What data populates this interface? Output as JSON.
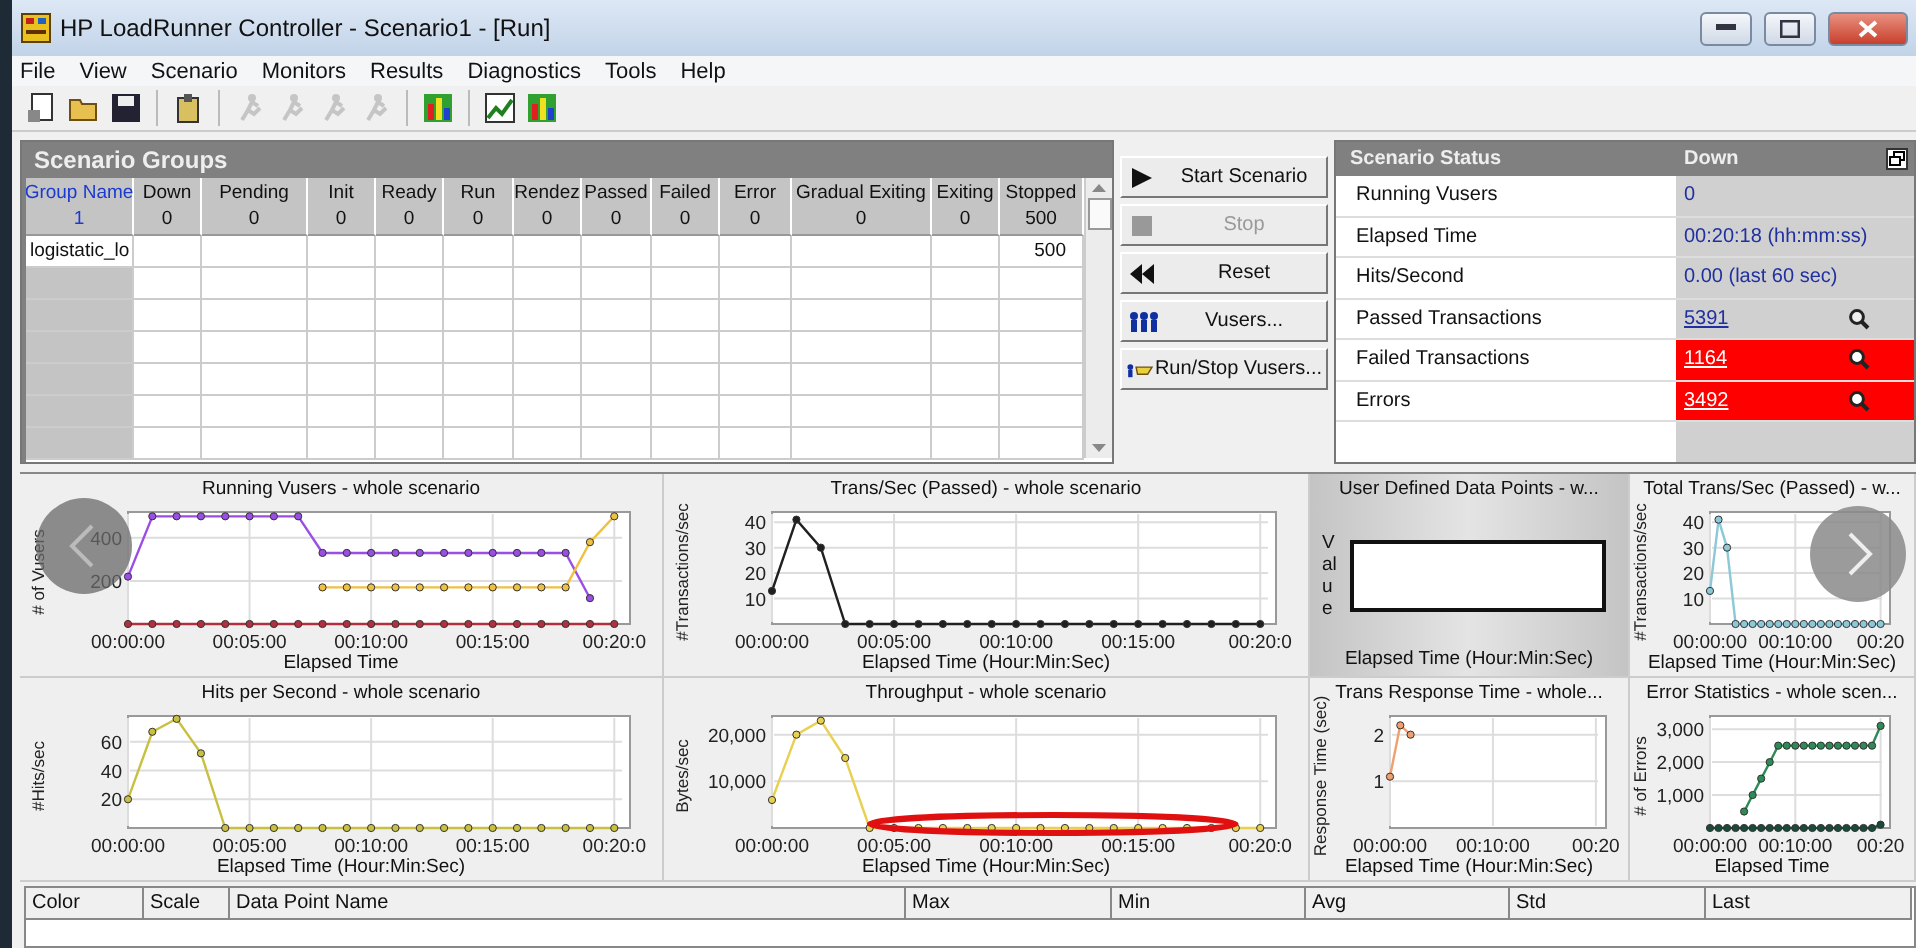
{
  "window": {
    "title": "HP LoadRunner Controller - Scenario1 - [Run]"
  },
  "menu": [
    "File",
    "View",
    "Scenario",
    "Monitors",
    "Results",
    "Diagnostics",
    "Tools",
    "Help"
  ],
  "toolbar": [
    {
      "kind": "new",
      "disabled": false
    },
    {
      "kind": "open",
      "disabled": false
    },
    {
      "kind": "save",
      "disabled": false
    },
    {
      "kind": "host",
      "disabled": false
    },
    {
      "kind": "run",
      "disabled": true
    },
    {
      "kind": "run",
      "disabled": true
    },
    {
      "kind": "run",
      "disabled": true
    },
    {
      "kind": "run",
      "disabled": true
    },
    {
      "kind": "monitor",
      "disabled": false
    },
    {
      "kind": "analysis",
      "disabled": false
    },
    {
      "kind": "monitor",
      "disabled": false
    }
  ],
  "scenario_groups": {
    "title": "Scenario Groups",
    "columns": [
      {
        "name": "Group Name",
        "total": "1"
      },
      {
        "name": "Down",
        "total": "0"
      },
      {
        "name": "Pending",
        "total": "0"
      },
      {
        "name": "Init",
        "total": "0"
      },
      {
        "name": "Ready",
        "total": "0"
      },
      {
        "name": "Run",
        "total": "0"
      },
      {
        "name": "Rendez",
        "total": "0"
      },
      {
        "name": "Passed",
        "total": "0"
      },
      {
        "name": "Failed",
        "total": "0"
      },
      {
        "name": "Error",
        "total": "0"
      },
      {
        "name": "Gradual Exiting",
        "total": "0"
      },
      {
        "name": "Exiting",
        "total": "0"
      },
      {
        "name": "Stopped",
        "total": "500"
      }
    ],
    "rows": [
      {
        "group_name": "logistatic_lo",
        "stopped": "500"
      }
    ]
  },
  "buttons": [
    {
      "label": "Start Scenario",
      "kind": "start",
      "disabled": false
    },
    {
      "label": "Stop",
      "kind": "stop",
      "disabled": true
    },
    {
      "label": "Reset",
      "kind": "reset",
      "disabled": false
    },
    {
      "label": "Vusers...",
      "kind": "vusers",
      "disabled": false
    },
    {
      "label": "Run/Stop Vusers...",
      "kind": "runstop",
      "disabled": false
    }
  ],
  "scenario_status": {
    "title": "Scenario Status",
    "state": "Down",
    "rows": [
      {
        "label": "Running Vusers",
        "value": "0",
        "kind": "text",
        "alert": false
      },
      {
        "label": "Elapsed Time",
        "value": "00:20:18 (hh:mm:ss)",
        "kind": "text",
        "alert": false
      },
      {
        "label": "Hits/Second",
        "value": "0.00 (last 60 sec)",
        "kind": "text",
        "alert": false
      },
      {
        "label": "Passed Transactions",
        "value": "5391",
        "kind": "link",
        "alert": false
      },
      {
        "label": "Failed Transactions",
        "value": "1164",
        "kind": "link",
        "alert": true
      },
      {
        "label": "Errors",
        "value": "3492",
        "kind": "link",
        "alert": true
      }
    ]
  },
  "graphs": [
    {
      "kind": "chart",
      "selected": false,
      "circled": false,
      "chart_data": {
        "type": "line",
        "title": "Running Vusers - whole scenario",
        "xlabel": "Elapsed Time",
        "ylabel": "# of Vusers",
        "grid": true,
        "x": [
          0,
          1,
          2,
          3,
          4,
          5,
          6,
          7,
          8,
          9,
          10,
          11,
          12,
          13,
          14,
          15,
          16,
          17,
          18,
          19,
          20
        ],
        "xlim": [
          0,
          20.4
        ],
        "ylim": [
          0,
          520
        ],
        "xticks": [
          {
            "value": 0,
            "label": "00:00:00"
          },
          {
            "value": 5,
            "label": "00:05:00"
          },
          {
            "value": 10,
            "label": "00:10:00"
          },
          {
            "value": 15,
            "label": "00:15:00"
          },
          {
            "value": 20,
            "label": "00:20:0"
          }
        ],
        "yticks": [
          200,
          400
        ],
        "series": [
          {
            "color": "#b03040",
            "marker": true,
            "values": [
              0,
              0,
              0,
              0,
              0,
              0,
              0,
              0,
              0,
              0,
              0,
              0,
              0,
              0,
              0,
              0,
              0,
              0,
              0,
              0,
              0
            ]
          },
          {
            "color": "#9a4ee6",
            "marker": true,
            "values": [
              220,
              500,
              500,
              500,
              500,
              500,
              500,
              500,
              330,
              330,
              330,
              330,
              330,
              330,
              330,
              330,
              330,
              330,
              330,
              120,
              null
            ]
          },
          {
            "color": "#f0c040",
            "marker": true,
            "values": [
              null,
              null,
              null,
              null,
              null,
              null,
              null,
              null,
              170,
              170,
              170,
              170,
              170,
              170,
              170,
              170,
              170,
              170,
              170,
              380,
              500
            ]
          }
        ]
      }
    },
    {
      "kind": "chart",
      "selected": false,
      "circled": false,
      "chart_data": {
        "type": "line",
        "title": "Trans/Sec (Passed) - whole scenario",
        "xlabel": "Elapsed Time (Hour:Min:Sec)",
        "ylabel": "#Transactions/sec",
        "grid": true,
        "x": [
          0,
          1,
          2,
          3,
          4,
          5,
          6,
          7,
          8,
          9,
          10,
          11,
          12,
          13,
          14,
          15,
          16,
          17,
          18,
          19,
          20
        ],
        "xlim": [
          0,
          20.4
        ],
        "ylim": [
          0,
          44
        ],
        "xticks": [
          {
            "value": 0,
            "label": "00:00:00"
          },
          {
            "value": 5,
            "label": "00:05:00"
          },
          {
            "value": 10,
            "label": "00:10:00"
          },
          {
            "value": 15,
            "label": "00:15:00"
          },
          {
            "value": 20,
            "label": "00:20:0"
          }
        ],
        "yticks": [
          10,
          20,
          30,
          40
        ],
        "series": [
          {
            "color": "#202020",
            "marker": true,
            "values": [
              13,
              41,
              30,
              0,
              0,
              0,
              0,
              0,
              0,
              0,
              0,
              0,
              0,
              0,
              0,
              0,
              0,
              0,
              0,
              0,
              0
            ]
          }
        ]
      }
    },
    {
      "kind": "empty",
      "selected": true,
      "title": "User Defined Data Points - w...",
      "ylabel": "Value",
      "xlabel": "Elapsed Time (Hour:Min:Sec)"
    },
    {
      "kind": "chart",
      "selected": false,
      "circled": false,
      "chart_data": {
        "type": "line",
        "title": "Total Trans/Sec (Passed) - w...",
        "xlabel": "Elapsed Time (Hour:Min:Sec)",
        "ylabel": "#Transactions/sec",
        "grid": true,
        "x": [
          0,
          1,
          2,
          3,
          4,
          5,
          6,
          7,
          8,
          9,
          10,
          11,
          12,
          13,
          14,
          15,
          16,
          17,
          18,
          19,
          20
        ],
        "xlim": [
          0,
          20.4
        ],
        "ylim": [
          0,
          44
        ],
        "xticks": [
          {
            "value": 0,
            "label": "00:00:00"
          },
          {
            "value": 10,
            "label": "00:10:00"
          },
          {
            "value": 20,
            "label": "00:20"
          }
        ],
        "yticks": [
          10,
          20,
          30,
          40
        ],
        "series": [
          {
            "color": "#8cc8d8",
            "marker": true,
            "values": [
              13,
              41,
              30,
              0,
              0,
              0,
              0,
              0,
              0,
              0,
              0,
              0,
              0,
              0,
              0,
              0,
              0,
              0,
              0,
              0,
              0
            ]
          }
        ]
      }
    },
    {
      "kind": "chart",
      "selected": false,
      "circled": false,
      "chart_data": {
        "type": "line",
        "title": "Hits per Second - whole scenario",
        "xlabel": "Elapsed Time (Hour:Min:Sec)",
        "ylabel": "#Hits/sec",
        "grid": true,
        "x": [
          0,
          1,
          2,
          3,
          4,
          5,
          6,
          7,
          8,
          9,
          10,
          11,
          12,
          13,
          14,
          15,
          16,
          17,
          18,
          19,
          20
        ],
        "xlim": [
          0,
          20.4
        ],
        "ylim": [
          0,
          78
        ],
        "xticks": [
          {
            "value": 0,
            "label": "00:00:00"
          },
          {
            "value": 5,
            "label": "00:05:00"
          },
          {
            "value": 10,
            "label": "00:10:00"
          },
          {
            "value": 15,
            "label": "00:15:00"
          },
          {
            "value": 20,
            "label": "00:20:0"
          }
        ],
        "yticks": [
          20,
          40,
          60
        ],
        "series": [
          {
            "color": "#c8c040",
            "marker": true,
            "values": [
              20,
              67,
              76,
              52,
              0,
              0,
              0,
              0,
              0,
              0,
              0,
              0,
              0,
              0,
              0,
              0,
              0,
              0,
              0,
              0,
              0
            ]
          }
        ]
      }
    },
    {
      "kind": "chart",
      "selected": false,
      "circled": true,
      "chart_data": {
        "type": "line",
        "title": "Throughput - whole scenario",
        "xlabel": "Elapsed Time (Hour:Min:Sec)",
        "ylabel": "Bytes/sec",
        "grid": true,
        "x": [
          0,
          1,
          2,
          3,
          4,
          5,
          6,
          7,
          8,
          9,
          10,
          11,
          12,
          13,
          14,
          15,
          16,
          17,
          18,
          19,
          20
        ],
        "xlim": [
          0,
          20.4
        ],
        "ylim": [
          0,
          24000
        ],
        "xticks": [
          {
            "value": 0,
            "label": "00:00:00"
          },
          {
            "value": 5,
            "label": "00:05:00"
          },
          {
            "value": 10,
            "label": "00:10:00"
          },
          {
            "value": 15,
            "label": "00:15:00"
          },
          {
            "value": 20,
            "label": "00:20:0"
          }
        ],
        "yticks": [
          {
            "value": 10000,
            "label": "10,000"
          },
          {
            "value": 20000,
            "label": "20,000"
          }
        ],
        "series": [
          {
            "color": "#e8d050",
            "marker": true,
            "values": [
              6000,
              20000,
              23000,
              15000,
              0,
              0,
              0,
              0,
              0,
              0,
              0,
              0,
              0,
              0,
              0,
              0,
              0,
              0,
              0,
              0,
              0
            ]
          }
        ]
      }
    },
    {
      "kind": "chart",
      "selected": false,
      "circled": false,
      "chart_data": {
        "type": "line",
        "title": "Trans Response Time - whole...",
        "xlabel": "Elapsed Time (Hour:Min:Sec)",
        "ylabel": "Response Time (sec)",
        "grid": true,
        "x": [
          0,
          1,
          2
        ],
        "xlim": [
          0,
          20.4
        ],
        "ylim": [
          0,
          2.4
        ],
        "xticks": [
          {
            "value": 0,
            "label": "00:00:00"
          },
          {
            "value": 10,
            "label": "00:10:00"
          },
          {
            "value": 20,
            "label": "00:20"
          }
        ],
        "yticks": [
          1,
          2
        ],
        "series": [
          {
            "color": "#f0a070",
            "marker": true,
            "values": [
              1.1,
              2.2,
              2.0
            ]
          }
        ]
      }
    },
    {
      "kind": "chart",
      "selected": false,
      "circled": false,
      "chart_data": {
        "type": "line",
        "title": "Error Statistics - whole scen...",
        "xlabel": "Elapsed Time",
        "ylabel": "# of Errors",
        "grid": true,
        "x": [
          0,
          1,
          2,
          3,
          4,
          5,
          6,
          7,
          8,
          9,
          10,
          11,
          12,
          13,
          14,
          15,
          16,
          17,
          18,
          19,
          20
        ],
        "xlim": [
          0,
          20.4
        ],
        "ylim": [
          0,
          3400
        ],
        "xticks": [
          {
            "value": 0,
            "label": "00:00:00"
          },
          {
            "value": 10,
            "label": "00:10:00"
          },
          {
            "value": 20,
            "label": "00:20"
          }
        ],
        "yticks": [
          {
            "value": 1000,
            "label": "1,000"
          },
          {
            "value": 2000,
            "label": "2,000"
          },
          {
            "value": 3000,
            "label": "3,000"
          }
        ],
        "series": [
          {
            "color": "#1a4a3a",
            "marker": true,
            "values": [
              0,
              0,
              0,
              0,
              0,
              0,
              0,
              0,
              0,
              0,
              0,
              0,
              0,
              0,
              0,
              0,
              0,
              0,
              0,
              0,
              100
            ]
          },
          {
            "color": "#2e8b57",
            "marker": true,
            "values": [
              null,
              null,
              null,
              null,
              500,
              1000,
              1500,
              2000,
              2500,
              2500,
              2500,
              2500,
              2500,
              2500,
              2500,
              2500,
              2500,
              2500,
              2500,
              2500,
              3100
            ]
          }
        ]
      }
    }
  ],
  "legend": {
    "columns": [
      "Color",
      "Scale",
      "Data Point Name",
      "Max",
      "Min",
      "Avg",
      "Std",
      "Last"
    ]
  }
}
